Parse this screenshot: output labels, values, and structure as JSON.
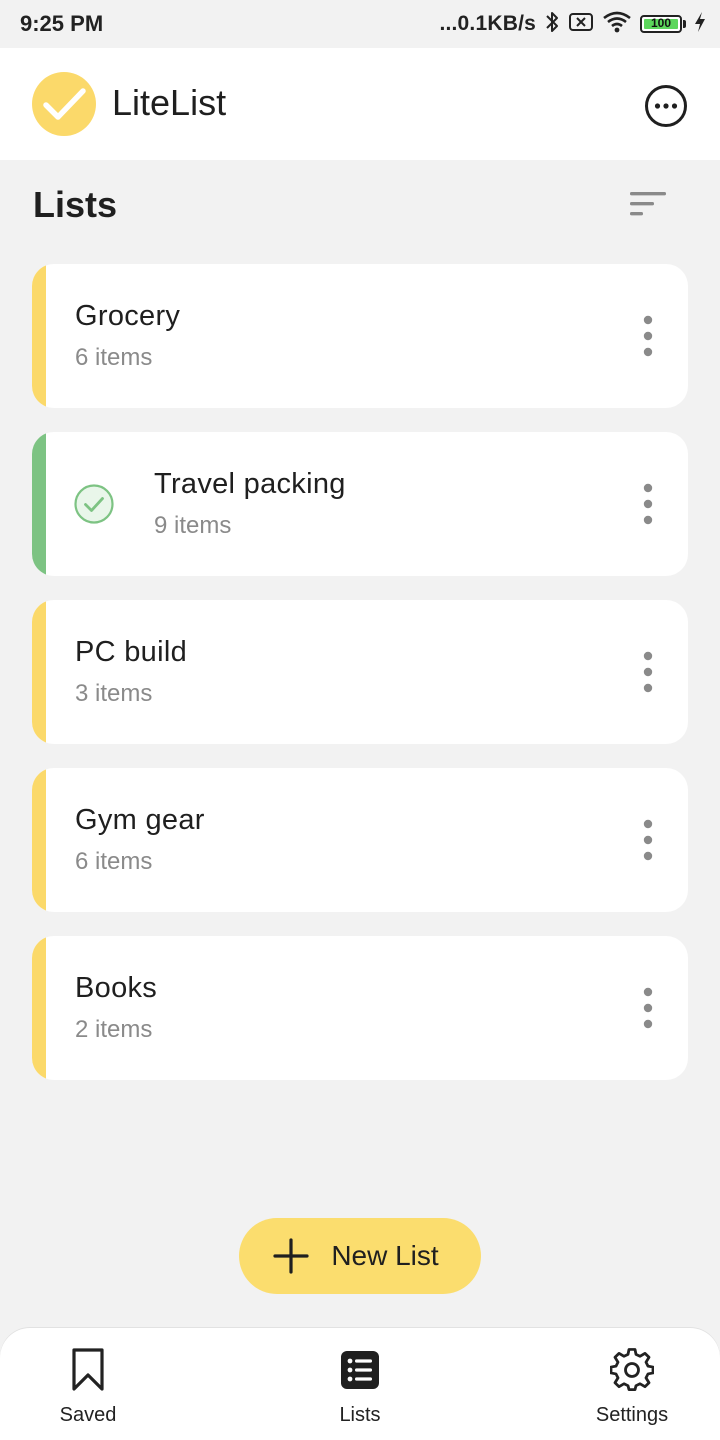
{
  "status_bar": {
    "time": "9:25 PM",
    "network_speed": "...0.1KB/s",
    "battery_level": "100",
    "icons": [
      "bluetooth-icon",
      "sim-off-icon",
      "wifi-icon",
      "battery-icon",
      "charging-icon"
    ]
  },
  "app_bar": {
    "title": "LiteList",
    "logo_icon": "check-icon",
    "menu_icon": "more-horizontal-icon"
  },
  "section": {
    "title": "Lists",
    "sort_icon": "sort-icon"
  },
  "lists": [
    {
      "title": "Grocery",
      "count": "6 items",
      "completed": false
    },
    {
      "title": "Travel packing",
      "count": "9 items",
      "completed": true
    },
    {
      "title": "PC build",
      "count": "3 items",
      "completed": false
    },
    {
      "title": "Gym gear",
      "count": "6 items",
      "completed": false
    },
    {
      "title": "Books",
      "count": "2 items",
      "completed": false
    }
  ],
  "fab": {
    "label": "New List",
    "icon": "plus-icon"
  },
  "bottom_nav": {
    "items": [
      {
        "label": "Saved",
        "icon": "bookmark-icon"
      },
      {
        "label": "Lists",
        "icon": "list-icon"
      },
      {
        "label": "Settings",
        "icon": "gear-icon"
      }
    ]
  },
  "colors": {
    "accent_yellow": "#fbd96a",
    "accent_green": "#7dc383",
    "background": "#f2f2f2",
    "card": "#ffffff",
    "secondary_text": "#8a8a8a"
  }
}
